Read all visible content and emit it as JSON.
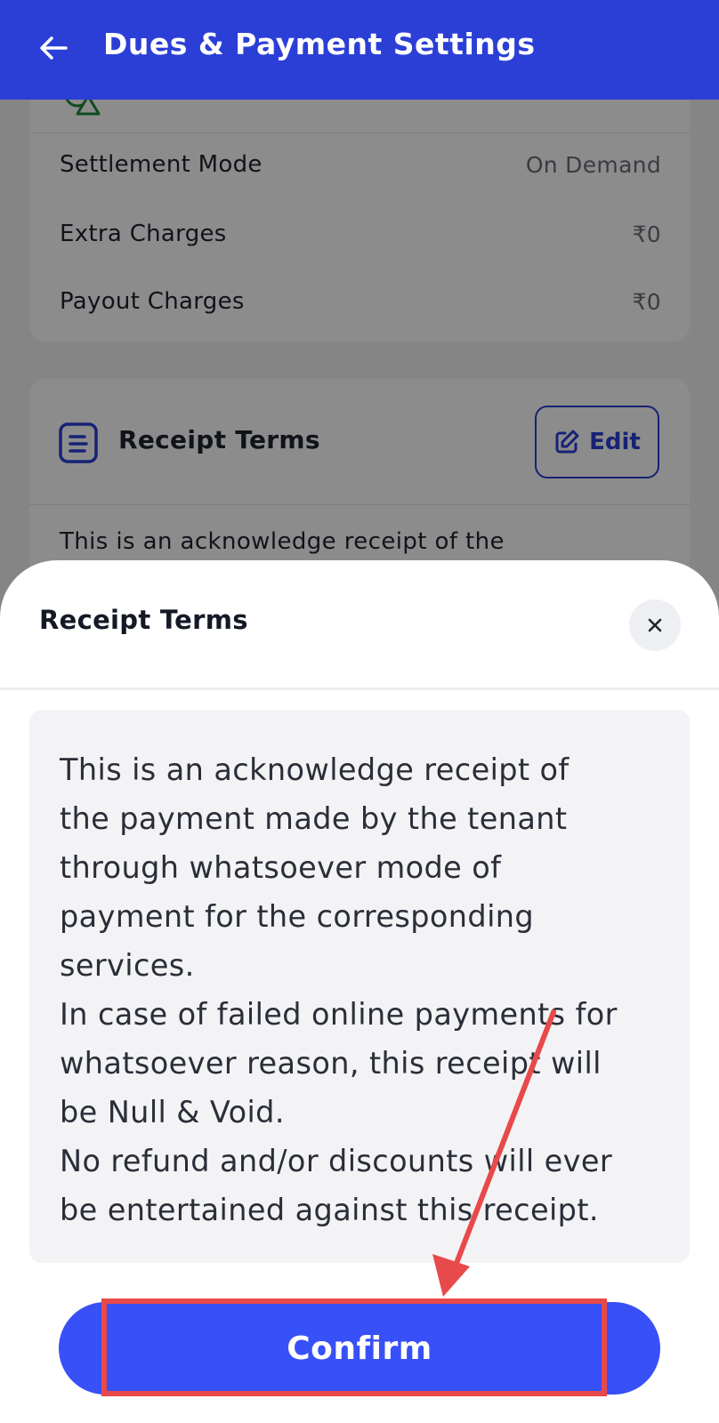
{
  "appbar": {
    "title": "Dues & Payment Settings",
    "back_icon": "arrow-left-icon"
  },
  "settlement_card": {
    "header_icon": "warning-icon",
    "rows": [
      {
        "label": "Settlement Mode",
        "value": "On Demand"
      },
      {
        "label": "Extra Charges",
        "value": "₹0"
      },
      {
        "label": "Payout Charges",
        "value": "₹0"
      }
    ]
  },
  "receipt_card": {
    "title": "Receipt Terms",
    "edit_label": "Edit",
    "preview_text": "This is an acknowledge receipt of the"
  },
  "sheet": {
    "title": "Receipt Terms",
    "close_symbol": "×",
    "terms_lines": [
      "This is an acknowledge receipt of",
      "the payment made by the tenant",
      "through whatsoever mode of",
      "payment for the corresponding",
      "services.",
      "In case of failed online payments for",
      "whatsoever reason, this receipt will",
      "be Null & Void.",
      "No refund and/or discounts will ever",
      "be entertained against this receipt."
    ],
    "confirm_label": "Confirm"
  },
  "colors": {
    "primary": "#2b3fd6",
    "confirm": "#3850f7",
    "annotation": "#e8494a"
  }
}
